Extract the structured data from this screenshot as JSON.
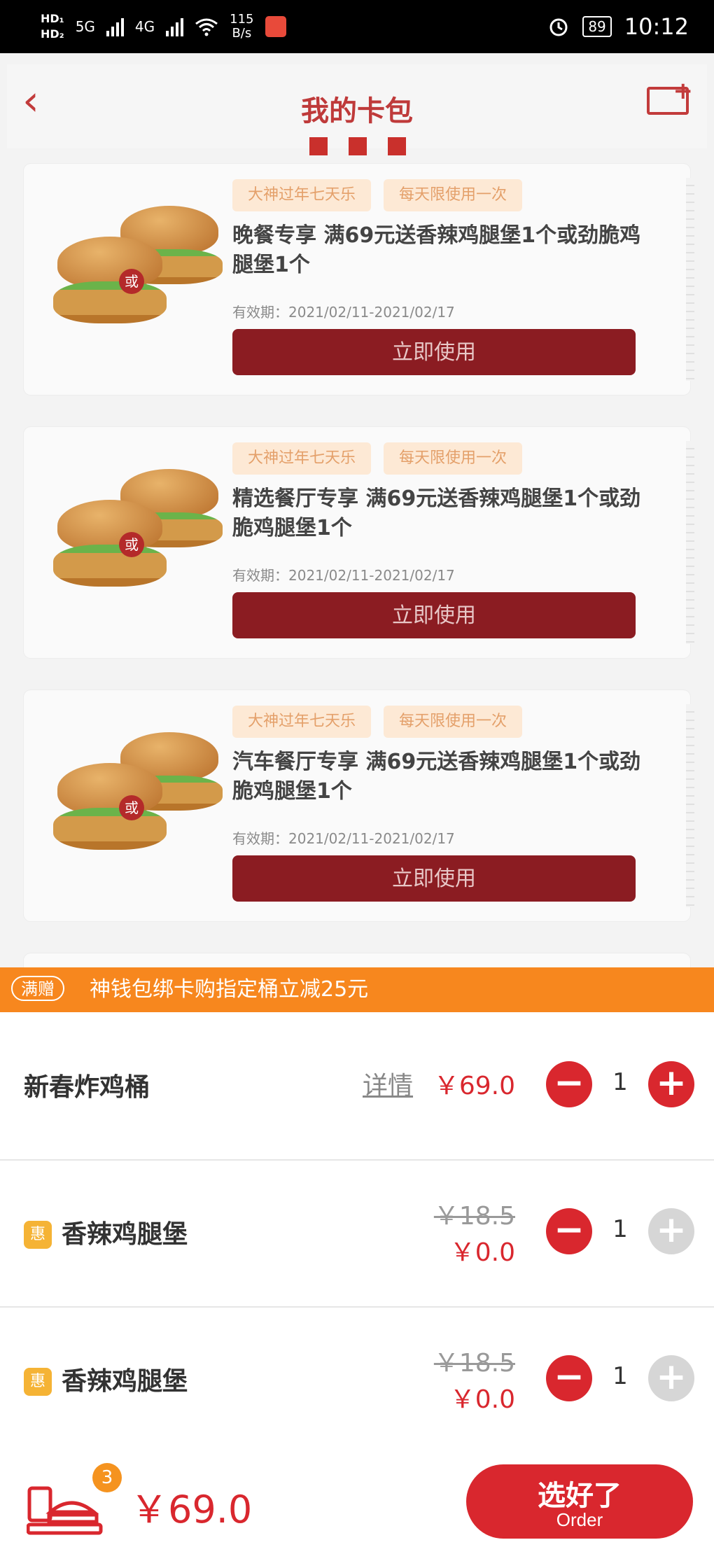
{
  "status_bar": {
    "net_speed": "115",
    "net_unit": "B/s",
    "battery": "89",
    "time": "10:12",
    "hd1": "HD₁",
    "hd2": "HD₂",
    "sig1": "5G",
    "sig2": "4G"
  },
  "header": {
    "title": "我的卡包"
  },
  "coupons": [
    {
      "tag1": "大神过年七天乐",
      "tag2": "每天限使用一次",
      "title": "晚餐专享 满69元送香辣鸡腿堡1个或劲脆鸡腿堡1个",
      "validity": "有效期：2021/02/11-2021/02/17",
      "button": "立即使用",
      "or": "或"
    },
    {
      "tag1": "大神过年七天乐",
      "tag2": "每天限使用一次",
      "title": "精选餐厅专享 满69元送香辣鸡腿堡1个或劲脆鸡腿堡1个",
      "validity": "有效期：2021/02/11-2021/02/17",
      "button": "立即使用",
      "or": "或"
    },
    {
      "tag1": "大神过年七天乐",
      "tag2": "每天限使用一次",
      "title": "汽车餐厅专享 满69元送香辣鸡腿堡1个或劲脆鸡腿堡1个",
      "validity": "有效期：2021/02/11-2021/02/17",
      "button": "立即使用",
      "or": "或"
    }
  ],
  "promo": {
    "tag": "满赠",
    "text": "神钱包绑卡购指定桶立减25元"
  },
  "cart_items": [
    {
      "name": "新春炸鸡桶",
      "detail": "详情",
      "price": "￥69.0",
      "qty": "1"
    },
    {
      "badge": "惠",
      "name": "香辣鸡腿堡",
      "old_price": "￥18.5",
      "price": "￥0.0",
      "qty": "1"
    },
    {
      "badge": "惠",
      "name": "香辣鸡腿堡",
      "old_price": "￥18.5",
      "price": "￥0.0",
      "qty": "1"
    }
  ],
  "controls": {
    "minus": "−",
    "plus": "+"
  },
  "bottom": {
    "count": "3",
    "total": "￥69.0",
    "order_main": "选好了",
    "order_sub": "Order"
  }
}
